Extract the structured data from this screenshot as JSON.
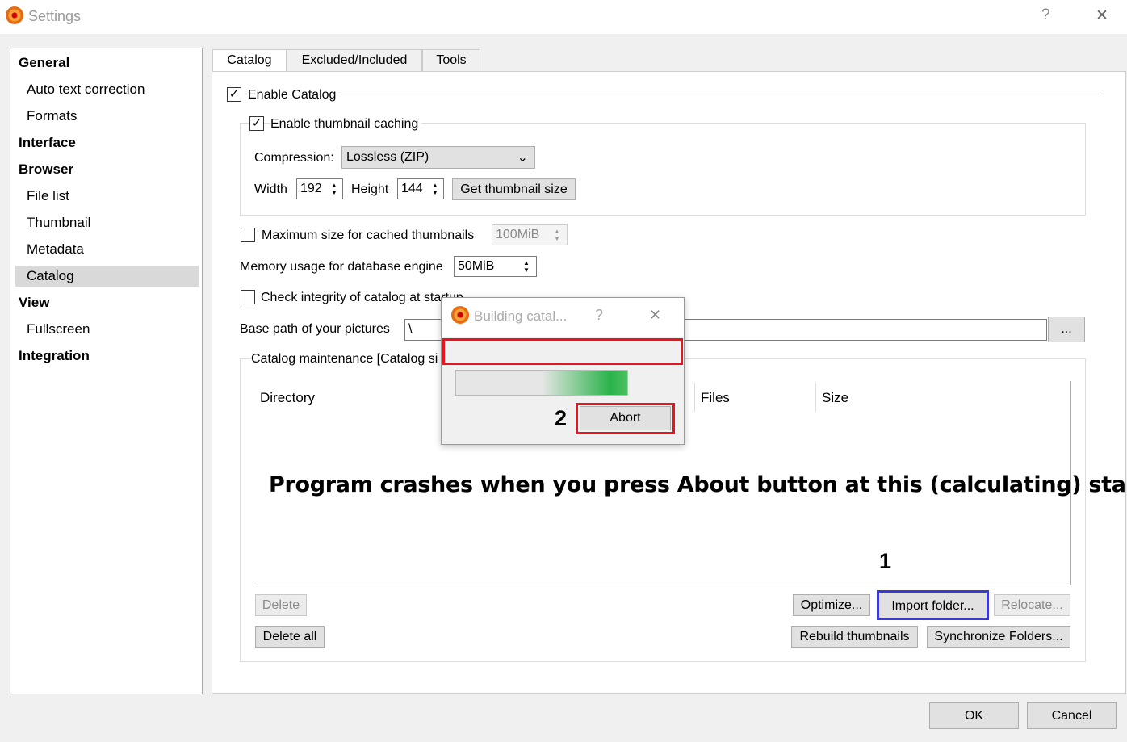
{
  "window": {
    "title": "Settings",
    "help": "?",
    "close": "✕"
  },
  "sidebar": {
    "items": [
      {
        "label": "General",
        "header": true
      },
      {
        "label": "Auto text correction"
      },
      {
        "label": "Formats"
      },
      {
        "label": "Interface",
        "header": true
      },
      {
        "label": "Browser",
        "header": true
      },
      {
        "label": "File list"
      },
      {
        "label": "Thumbnail"
      },
      {
        "label": "Metadata"
      },
      {
        "label": "Catalog",
        "selected": true
      },
      {
        "label": "View",
        "header": true
      },
      {
        "label": "Fullscreen"
      },
      {
        "label": "Integration",
        "header": true
      }
    ]
  },
  "tabs": [
    "Catalog",
    "Excluded/Included",
    "Tools"
  ],
  "catalog": {
    "enable_catalog": "Enable Catalog",
    "enable_thumb": "Enable thumbnail caching",
    "compression_label": "Compression:",
    "compression_value": "Lossless (ZIP)",
    "width_label": "Width",
    "width_value": "192",
    "height_label": "Height",
    "height_value": "144",
    "get_thumb": "Get thumbnail size",
    "max_size_label": "Maximum size for cached thumbnails",
    "max_size_value": "100MiB",
    "memory_label": "Memory usage for database engine",
    "memory_value": "50MiB",
    "check_integrity": "Check integrity of catalog at startup",
    "base_path_label": "Base path of your pictures",
    "base_path_value": "\\",
    "browse": "...",
    "maintenance_title": "Catalog maintenance [Catalog si",
    "columns": [
      "Directory",
      "Files",
      "Size"
    ],
    "buttons": {
      "delete": "Delete",
      "delete_all": "Delete all",
      "optimize": "Optimize...",
      "import": "Import folder...",
      "relocate": "Relocate...",
      "rebuild": "Rebuild thumbnails",
      "sync": "Synchronize Folders..."
    }
  },
  "annotation": {
    "message": "Program crashes when you press About button at this (calculating) stage.",
    "step1": "1",
    "step2": "2"
  },
  "dialog": {
    "title": "Building catal...",
    "help": "?",
    "close": "✕",
    "abort": "Abort",
    "progress": 0.5
  },
  "footer": {
    "ok": "OK",
    "cancel": "Cancel"
  }
}
